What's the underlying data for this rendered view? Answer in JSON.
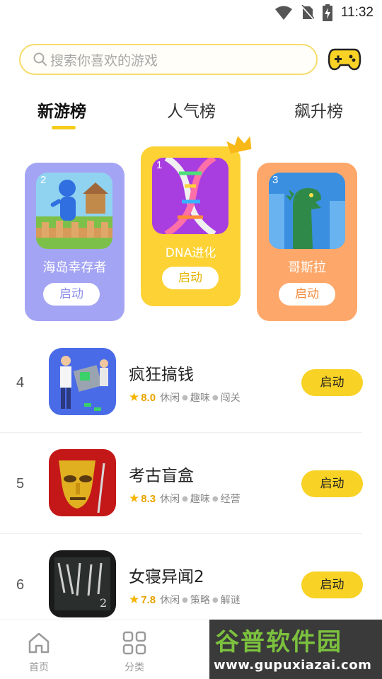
{
  "status_bar": {
    "time": "11:32"
  },
  "search": {
    "placeholder": "搜索你喜欢的游戏"
  },
  "tabs": [
    {
      "label": "新游榜",
      "active": true
    },
    {
      "label": "人气榜",
      "active": false
    },
    {
      "label": "飙升榜",
      "active": false
    }
  ],
  "podium": [
    {
      "rank": "2",
      "name": "海岛幸存者",
      "button": "启动",
      "color": "#a4a4f4"
    },
    {
      "rank": "1",
      "name": "DNA进化",
      "button": "启动",
      "color": "#fcd235"
    },
    {
      "rank": "3",
      "name": "哥斯拉",
      "button": "启动",
      "color": "#fda86a"
    }
  ],
  "list": [
    {
      "rank": "4",
      "title": "疯狂搞钱",
      "score": "8.0",
      "tags": [
        "休闲",
        "趣味",
        "闯关"
      ],
      "button": "启动"
    },
    {
      "rank": "5",
      "title": "考古盲盒",
      "score": "8.3",
      "tags": [
        "休闲",
        "趣味",
        "经营"
      ],
      "button": "启动"
    },
    {
      "rank": "6",
      "title": "女寝异闻2",
      "score": "7.8",
      "tags": [
        "休闲",
        "策略",
        "解谜"
      ],
      "button": "启动"
    }
  ],
  "bottom_nav": [
    {
      "label": "首页",
      "icon": "home-icon"
    },
    {
      "label": "分类",
      "icon": "grid-icon"
    }
  ],
  "watermark": {
    "title": "谷普软件园",
    "url": "www.gupuxiazai.com"
  },
  "colors": {
    "accent": "#f8d225",
    "podium_purple": "#a4a4f4",
    "podium_yellow": "#fcd235",
    "podium_orange": "#fda86a"
  }
}
